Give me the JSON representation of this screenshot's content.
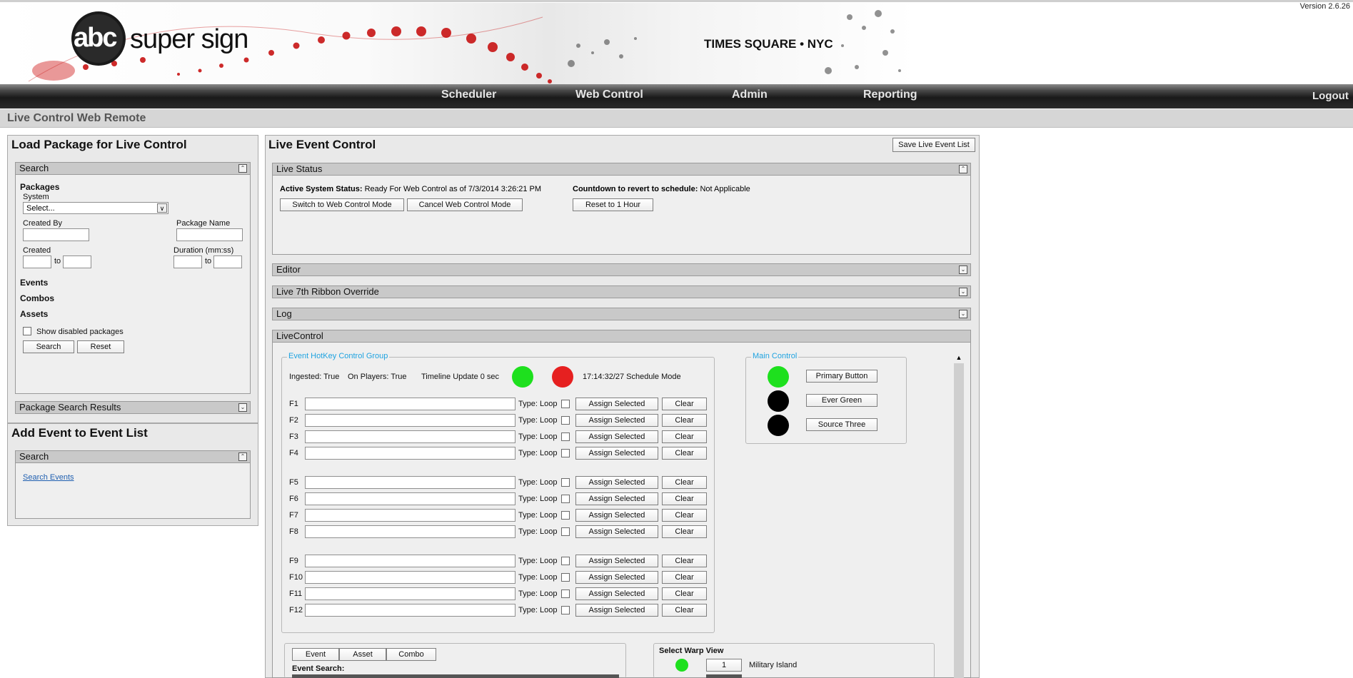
{
  "app": {
    "version": "Version 2.6.26",
    "logo_brand": "abc",
    "logo_text": "super sign",
    "location": "TIMES SQUARE • NYC"
  },
  "nav": {
    "items": [
      "Scheduler",
      "Web Control",
      "Admin",
      "Reporting"
    ],
    "logout": "Logout"
  },
  "page_title": "Live Control Web Remote",
  "left": {
    "load_title": "Load Package for Live Control",
    "search_head": "Search",
    "packages_label": "Packages",
    "system_label": "System",
    "system_value": "Select...",
    "created_by_label": "Created By",
    "package_name_label": "Package Name",
    "created_label": "Created",
    "to_label": "to",
    "duration_label": "Duration (mm:ss)",
    "events_label": "Events",
    "combos_label": "Combos",
    "assets_label": "Assets",
    "show_disabled_label": "Show disabled packages",
    "search_button": "Search",
    "reset_button": "Reset",
    "results_head": "Package Search Results",
    "add_title": "Add Event to Event List",
    "add_search_head": "Search",
    "search_events_link": "Search Events"
  },
  "right": {
    "title": "Live Event Control",
    "save_button": "Save Live Event List",
    "live_status_head": "Live Status",
    "active_status_label": "Active System Status:",
    "active_status_value": "Ready For Web Control as of 7/3/2014 3:26:21 PM",
    "countdown_label": "Countdown to revert to schedule:",
    "countdown_value": "Not Applicable",
    "switch_button": "Switch to Web Control Mode",
    "cancel_button": "Cancel Web Control Mode",
    "reset_hour_button": "Reset to 1 Hour",
    "editor_head": "Editor",
    "ribbon_head": "Live 7th Ribbon Override",
    "log_head": "Log",
    "livecontrol_head": "LiveControl"
  },
  "hotkey": {
    "legend": "Event HotKey Control Group",
    "ingested": "Ingested: True",
    "on_players": "On Players: True",
    "timeline_update": "Timeline Update 0 sec",
    "schedule_mode": "17:14:32/27 Schedule Mode",
    "type_label": "Type:",
    "loop_label": "Loop",
    "assign_label": "Assign Selected",
    "clear_label": "Clear",
    "keys": [
      "F1",
      "F2",
      "F3",
      "F4",
      "F5",
      "F6",
      "F7",
      "F8",
      "F9",
      "F10",
      "F11",
      "F12"
    ]
  },
  "main_control": {
    "legend": "Main Control",
    "buttons": [
      "Primary Button",
      "Ever Green",
      "Source Three"
    ]
  },
  "bottom": {
    "tabs": [
      "Event",
      "Asset",
      "Combo"
    ],
    "event_search_label": "Event Search:",
    "warp_title": "Select Warp View",
    "warp_value": "1",
    "warp_name": "Military Island"
  },
  "colors": {
    "green": "#1ee01e",
    "red": "#e62020",
    "black": "#000000",
    "legend_blue": "#1fa3e0"
  }
}
